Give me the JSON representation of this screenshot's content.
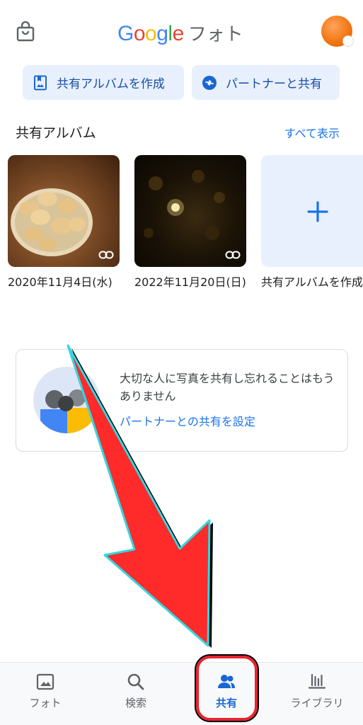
{
  "header": {
    "logo_google": "Google",
    "logo_product": "フォト",
    "bag_icon": "shopping-bag-icon",
    "avatar_color": "#f1730e"
  },
  "actions": {
    "create_album_label": "共有アルバムを作成",
    "partner_share_label": "パートナーと共有"
  },
  "shared_albums": {
    "title": "共有アルバム",
    "see_all": "すべて表示",
    "items": [
      {
        "label": "2020年11月4日(水)",
        "thumbnail": "potatoes-photo"
      },
      {
        "label": "2022年11月20日(日)",
        "thumbnail": "night-lights-photo"
      },
      {
        "label": "共有アルバムを作成",
        "thumbnail": "plus-icon"
      }
    ]
  },
  "partner_card": {
    "text": "大切な人に写真を共有し忘れることはもうありません",
    "link": "パートナーとの共有を設定"
  },
  "bottom_nav": {
    "items": [
      {
        "label": "フォト",
        "icon": "photo-icon",
        "active": false
      },
      {
        "label": "検索",
        "icon": "search-icon",
        "active": false
      },
      {
        "label": "共有",
        "icon": "people-icon",
        "active": true
      },
      {
        "label": "ライブラリ",
        "icon": "library-icon",
        "active": false
      }
    ]
  },
  "colors": {
    "accent": "#1a73e8",
    "button_bg": "#e8f0fe",
    "annotation_red": "#e8232f"
  }
}
